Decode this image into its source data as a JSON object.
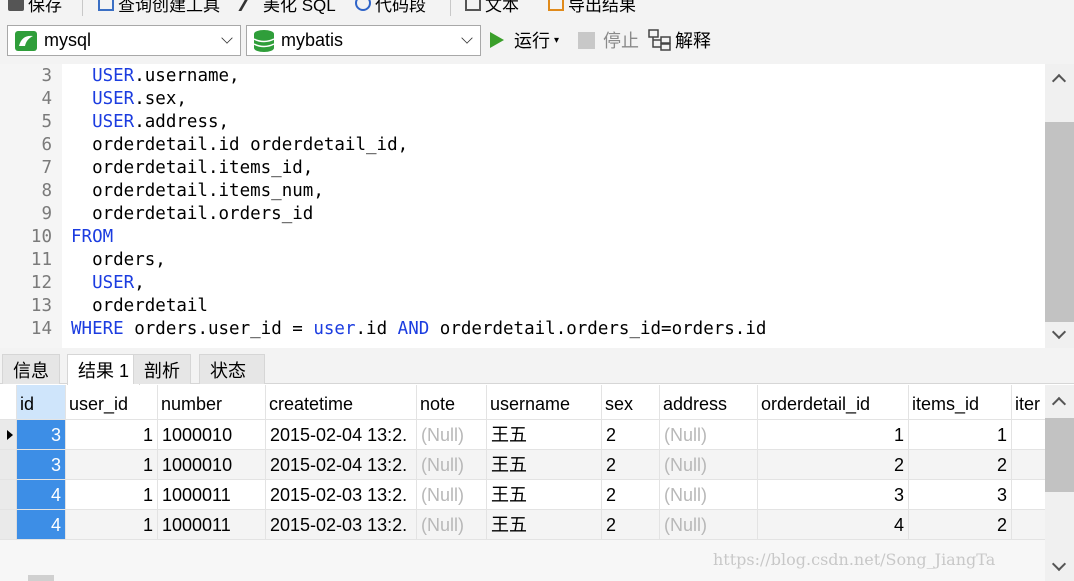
{
  "toolbar_top": {
    "save_label": "保存",
    "query_builder_label": "查询创建工具",
    "beautify_label": "美化 SQL",
    "snippet_label": "代码段",
    "text_label": "文本",
    "export_label": "导出结果"
  },
  "toolbar": {
    "connection": "mysql",
    "database": "mybatis",
    "run_label": "运行",
    "stop_label": "停止",
    "explain_label": "解释",
    "run_color": "#3a9f2a"
  },
  "editor": {
    "lines": [
      {
        "n": "3",
        "code": [
          {
            "t": "  "
          },
          {
            "t": "USER",
            "kw": true
          },
          {
            "t": ".username,"
          }
        ]
      },
      {
        "n": "4",
        "code": [
          {
            "t": "  "
          },
          {
            "t": "USER",
            "kw": true
          },
          {
            "t": ".sex,"
          }
        ]
      },
      {
        "n": "5",
        "code": [
          {
            "t": "  "
          },
          {
            "t": "USER",
            "kw": true
          },
          {
            "t": ".address,"
          }
        ]
      },
      {
        "n": "6",
        "code": [
          {
            "t": "  orderdetail.id orderdetail_id,"
          }
        ]
      },
      {
        "n": "7",
        "code": [
          {
            "t": "  orderdetail.items_id,"
          }
        ]
      },
      {
        "n": "8",
        "code": [
          {
            "t": "  orderdetail.items_num,"
          }
        ]
      },
      {
        "n": "9",
        "code": [
          {
            "t": "  orderdetail.orders_id"
          }
        ]
      },
      {
        "n": "10",
        "code": [
          {
            "t": "FROM",
            "kw": true
          }
        ]
      },
      {
        "n": "11",
        "code": [
          {
            "t": "  orders,"
          }
        ]
      },
      {
        "n": "12",
        "code": [
          {
            "t": "  "
          },
          {
            "t": "USER",
            "kw": true
          },
          {
            "t": ","
          }
        ]
      },
      {
        "n": "13",
        "code": [
          {
            "t": "  orderdetail"
          }
        ]
      },
      {
        "n": "14",
        "code": [
          {
            "t": "WHERE",
            "kw": true
          },
          {
            "t": " orders.user_id = "
          },
          {
            "t": "user",
            "kw": true
          },
          {
            "t": ".id "
          },
          {
            "t": "AND",
            "kw": true
          },
          {
            "t": " orderdetail.orders_id=orders.id"
          }
        ]
      }
    ],
    "keyword_color": "#1b3ce0"
  },
  "tabs": {
    "info": "信息",
    "result": "结果 1",
    "profile": "剖析",
    "status": "状态"
  },
  "grid": {
    "columns": [
      "id",
      "user_id",
      "number",
      "createtime",
      "note",
      "username",
      "sex",
      "address",
      "orderdetail_id",
      "items_id",
      "iter"
    ],
    "rows": [
      [
        "3",
        "1",
        "1000010",
        "2015-02-04 13:2.",
        "(Null)",
        "王五",
        "2",
        "(Null)",
        "1",
        "1",
        ""
      ],
      [
        "3",
        "1",
        "1000010",
        "2015-02-04 13:2.",
        "(Null)",
        "王五",
        "2",
        "(Null)",
        "2",
        "2",
        ""
      ],
      [
        "4",
        "1",
        "1000011",
        "2015-02-03 13:2.",
        "(Null)",
        "王五",
        "2",
        "(Null)",
        "3",
        "3",
        ""
      ],
      [
        "4",
        "1",
        "1000011",
        "2015-02-03 13:2.",
        "(Null)",
        "王五",
        "2",
        "(Null)",
        "4",
        "2",
        ""
      ]
    ],
    "selection_color": "#3d8ee6"
  },
  "watermark": "https://blog.csdn.net/Song_JiangTa"
}
